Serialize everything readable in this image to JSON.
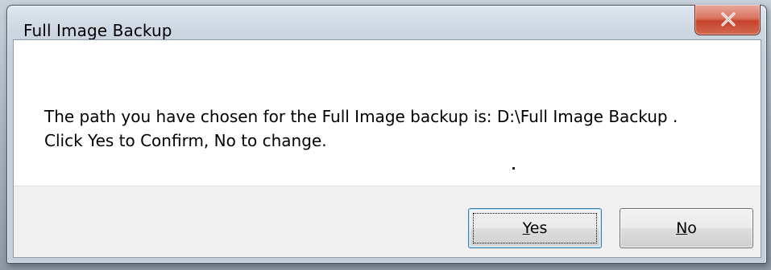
{
  "dialog": {
    "title": "Full Image Backup",
    "message_line1": "The path you have chosen for the Full Image backup is: D:\\Full Image Backup .",
    "message_line2": "Click Yes to Confirm, No to change.",
    "close_icon": "close-x-icon"
  },
  "buttons": {
    "yes": {
      "mnemonic": "Y",
      "rest": "es"
    },
    "no": {
      "mnemonic": "N",
      "rest": "o"
    }
  },
  "colors": {
    "close_button": "#c7432b",
    "focus_border": "#3c7fb1",
    "button_area": "#f0f0f0"
  }
}
